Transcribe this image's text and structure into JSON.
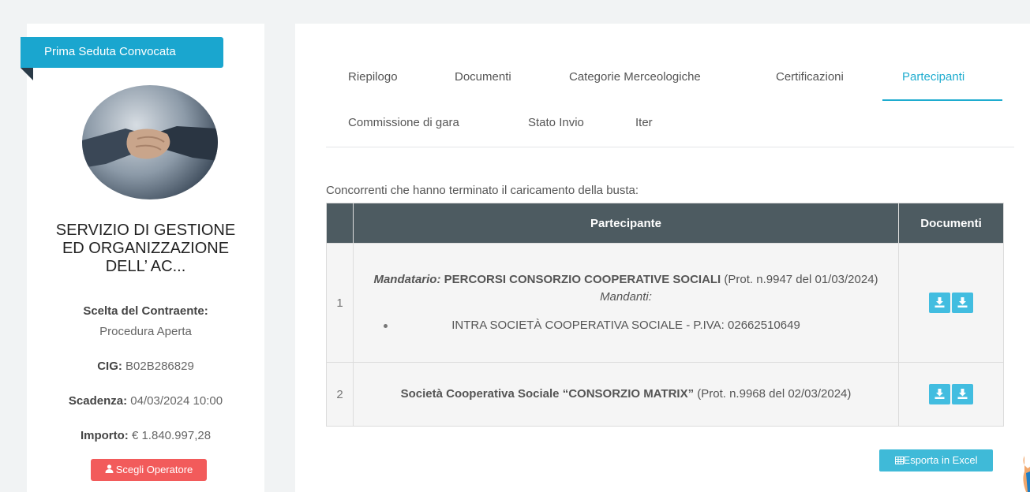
{
  "sidebar": {
    "badge": "Prima Seduta Convocata",
    "title_lines": [
      "SERVIZIO DI GESTIONE",
      "ED ORGANIZZAZIONE",
      "DELL’ AC..."
    ],
    "scelta_label": "Scelta del Contraente:",
    "scelta_value": "Procedura Aperta",
    "cig_label": "CIG:",
    "cig_value": "B02B286829",
    "scadenza_label": "Scadenza:",
    "scadenza_value": "04/03/2024 10:00",
    "importo_label": "Importo:",
    "importo_value": "€ 1.840.997,28",
    "scegli_label": "Scegli Operatore"
  },
  "tabs": [
    {
      "label": "Riepilogo"
    },
    {
      "label": "Documenti"
    },
    {
      "label": "Categorie Merceologiche"
    },
    {
      "label": "Certificazioni"
    },
    {
      "label": "Partecipanti",
      "active": true
    },
    {
      "label": "Commissione di gara"
    },
    {
      "label": "Stato Invio"
    },
    {
      "label": "Iter"
    }
  ],
  "caption": "Concorrenti che hanno terminato il caricamento della busta:",
  "table": {
    "headers": [
      "",
      "Partecipante",
      "Documenti"
    ],
    "rows": [
      {
        "num": "1",
        "mandatario_label": "Mandatario:",
        "name": "PERCORSI CONSORZIO COOPERATIVE SOCIALI",
        "prot": "(Prot. n.9947 del 01/03/2024)",
        "mandanti_label": "Mandanti:",
        "mandante": "INTRA SOCIETÀ COOPERATIVA SOCIALE - P.IVA: 02662510649"
      },
      {
        "num": "2",
        "name": "Società Cooperativa Sociale “CONSORZIO MATRIX”",
        "prot": "(Prot. n.9968 del 02/03/2024)"
      }
    ]
  },
  "export_label": "Esporta in Excel",
  "colors": {
    "accent": "#1eaccf",
    "badge": "#1aa6cf",
    "danger": "#f25b5b",
    "table_header": "#4d5b61",
    "download_button": "#42bde0"
  },
  "icons": [
    "user-icon",
    "download-icon",
    "table-icon",
    "handshake-image"
  ]
}
